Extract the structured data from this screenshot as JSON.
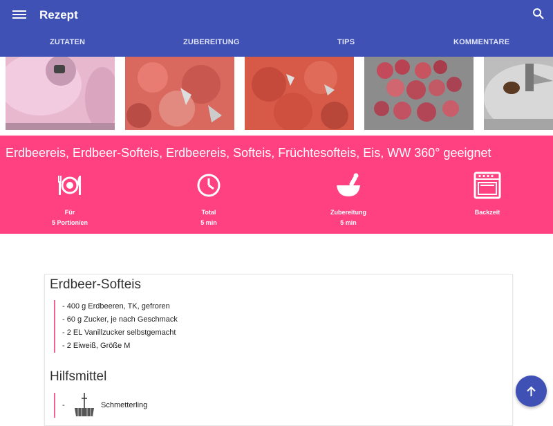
{
  "appbar": {
    "title": "Rezept",
    "menu_icon": "menu-icon",
    "search_icon": "search-icon",
    "color": "#3f51b5"
  },
  "tabs": [
    {
      "label": "ZUTATEN"
    },
    {
      "label": "ZUBEREITUNG"
    },
    {
      "label": "TIPS"
    },
    {
      "label": "KOMMENTARE"
    }
  ],
  "gallery": {
    "images": [
      {
        "icon": "photo-pink-mixture"
      },
      {
        "icon": "photo-strawberry-puree"
      },
      {
        "icon": "photo-strawberry-blended"
      },
      {
        "icon": "photo-frozen-strawberries"
      },
      {
        "icon": "photo-mixer-bowl"
      }
    ]
  },
  "banner": {
    "title": "Erdbeereis, Erdbeer-Softeis, Erdbeereis, Softeis, Früchtesofteis, Eis, WW 360° geeignet",
    "color": "#ff4081",
    "stats": [
      {
        "icon": "plate-cutlery-icon",
        "label": "Für",
        "value": "5 Portion/en"
      },
      {
        "icon": "clock-icon",
        "label": "Total",
        "value": "5 min"
      },
      {
        "icon": "mortar-pestle-icon",
        "label": "Zubereitung",
        "value": "5 min"
      },
      {
        "icon": "oven-icon",
        "label": "Backzeit",
        "value": ""
      }
    ]
  },
  "ingredients": {
    "heading": "Erdbeer-Softeis",
    "items": [
      "- 400 g Erdbeeren, TK, gefroren",
      "- 60 g Zucker, je nach Geschmack",
      "- 2 EL Vanillzucker selbstgemacht",
      "- 2 Eiweiß, Größe M"
    ]
  },
  "tools": {
    "heading": "Hilfsmittel",
    "items": [
      {
        "dash": "-",
        "icon": "butterfly-whisk-icon",
        "label": "Schmetterling"
      }
    ]
  },
  "fab": {
    "icon": "arrow-up-icon"
  }
}
